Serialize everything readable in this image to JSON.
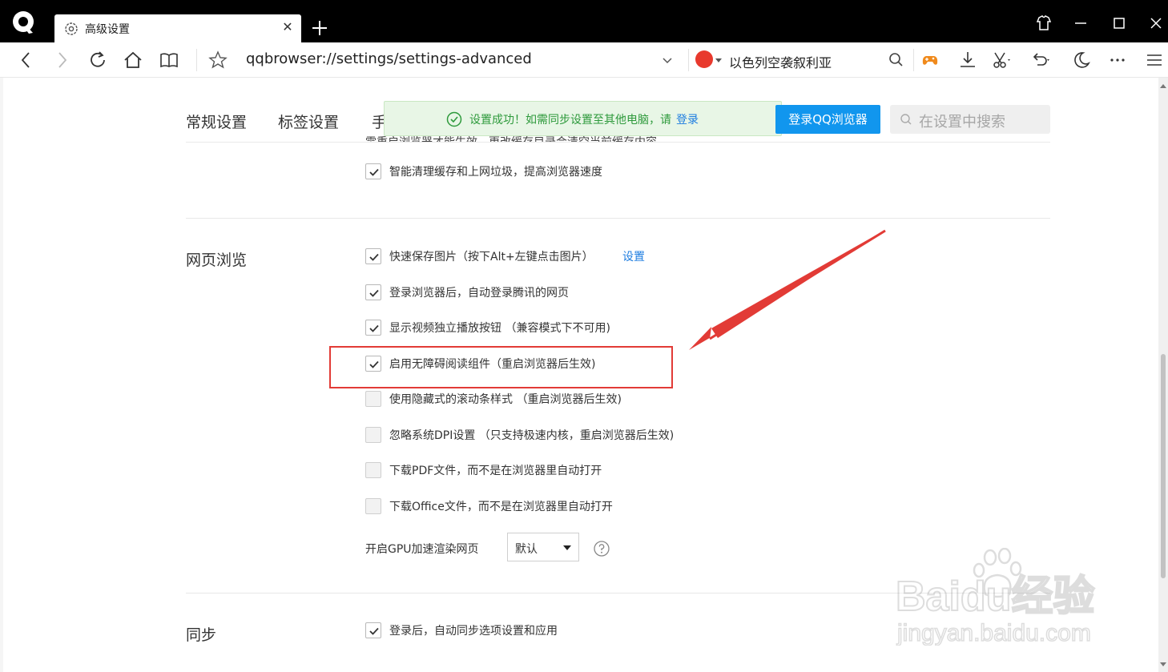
{
  "browser": {
    "tab_title": "高级设置",
    "url": "qqbrowser://settings/settings-advanced",
    "hot_search": "以色列空袭叙利亚"
  },
  "settings_header": {
    "tabs": [
      "常规设置",
      "标签设置",
      "手"
    ],
    "login_button": "登录QQ浏览器",
    "search_placeholder": "在设置中搜索"
  },
  "toast": {
    "message": "设置成功！如需同步设置至其他电脑，请",
    "link": "登录"
  },
  "cut_off_text": "需重启浏览器才能生效，更改缓存目录会清空当前缓存内容",
  "cache_option": {
    "label": "智能清理缓存和上网垃圾，提高浏览器速度",
    "checked": true
  },
  "web_browsing": {
    "title": "网页浏览",
    "settings_link": "设置",
    "options": [
      {
        "label": "快速保存图片（按下Alt+左键点击图片）",
        "checked": true
      },
      {
        "label": "登录浏览器后，自动登录腾讯的网页",
        "checked": true
      },
      {
        "label": "显示视频独立播放按钮 （兼容模式下不可用)",
        "checked": true
      },
      {
        "label": "启用无障碍阅读组件（重启浏览器后生效)",
        "checked": true
      },
      {
        "label": "使用隐藏式的滚动条样式 （重启浏览器后生效)",
        "checked": false
      },
      {
        "label": "忽略系统DPI设置 （只支持极速内核，重启浏览器后生效)",
        "checked": false
      },
      {
        "label": "下载PDF文件，而不是在浏览器里自动打开",
        "checked": false
      },
      {
        "label": "下载Office文件，而不是在浏览器里自动打开",
        "checked": false
      }
    ],
    "gpu_label": "开启GPU加速渲染网页",
    "gpu_value": "默认"
  },
  "sync": {
    "title": "同步",
    "options": [
      {
        "label": "登录后，自动同步选项设置和应用",
        "checked": true
      }
    ]
  },
  "watermark": {
    "brand": "Baidu经验",
    "site": "jingyan.baidu.com"
  },
  "colors": {
    "accent": "#1196ee",
    "highlight": "#e23b36",
    "toast_bg": "#e8f6e6",
    "toast_text": "#2e9a3c"
  }
}
